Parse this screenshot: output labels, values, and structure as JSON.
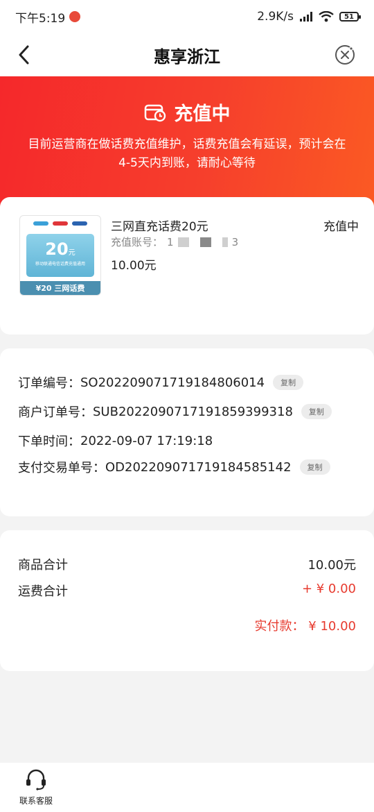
{
  "status_bar": {
    "time": "下午5:19",
    "net_speed": "2.9K/s",
    "battery": "51"
  },
  "nav": {
    "title": "惠享浙江",
    "back_icon": "chevron-left-icon",
    "close_icon": "close-circle-icon"
  },
  "hero": {
    "title": "充值中",
    "icon": "wallet-clock-icon",
    "description": "目前运营商在做话费充值维护，话费充值会有延误，预计会在4-5天内到账，请耐心等待",
    "colors": {
      "start": "#f5282b",
      "end": "#fb5a23"
    }
  },
  "product": {
    "name": "三网直充话费20元",
    "status": "充值中",
    "account_label": "充值账号：",
    "account_value_start": "1",
    "account_value_end": "3",
    "price": "10.00元",
    "image": {
      "amount": "20",
      "unit": "元",
      "sub_text": "移动联通电信话费充值通用",
      "bottom_text": "¥20 三网话费"
    }
  },
  "order_info": {
    "rows": [
      {
        "label": "订单编号：",
        "value": "SO20220907171918480​6014",
        "copy": "复制"
      },
      {
        "label": "商户订单号：",
        "value": "SUB20220907171918593​99318",
        "copy": "复制"
      },
      {
        "label": "下单时间：",
        "value": "2022-09-07 17:19:18"
      },
      {
        "label": "支付交易单号：",
        "value": "OD20220907171918458​5142",
        "copy": "复制"
      }
    ]
  },
  "summary": {
    "goods_label": "商品合计",
    "goods_value": "10.00元",
    "shipping_label": "运费合计",
    "shipping_value": "+ ¥ 0.00",
    "paid_label": "实付款：",
    "paid_value": "¥ 10.00",
    "accent_color": "#e73a2e"
  },
  "bottom_bar": {
    "service_label": "联系客服",
    "service_icon": "headset-icon"
  }
}
